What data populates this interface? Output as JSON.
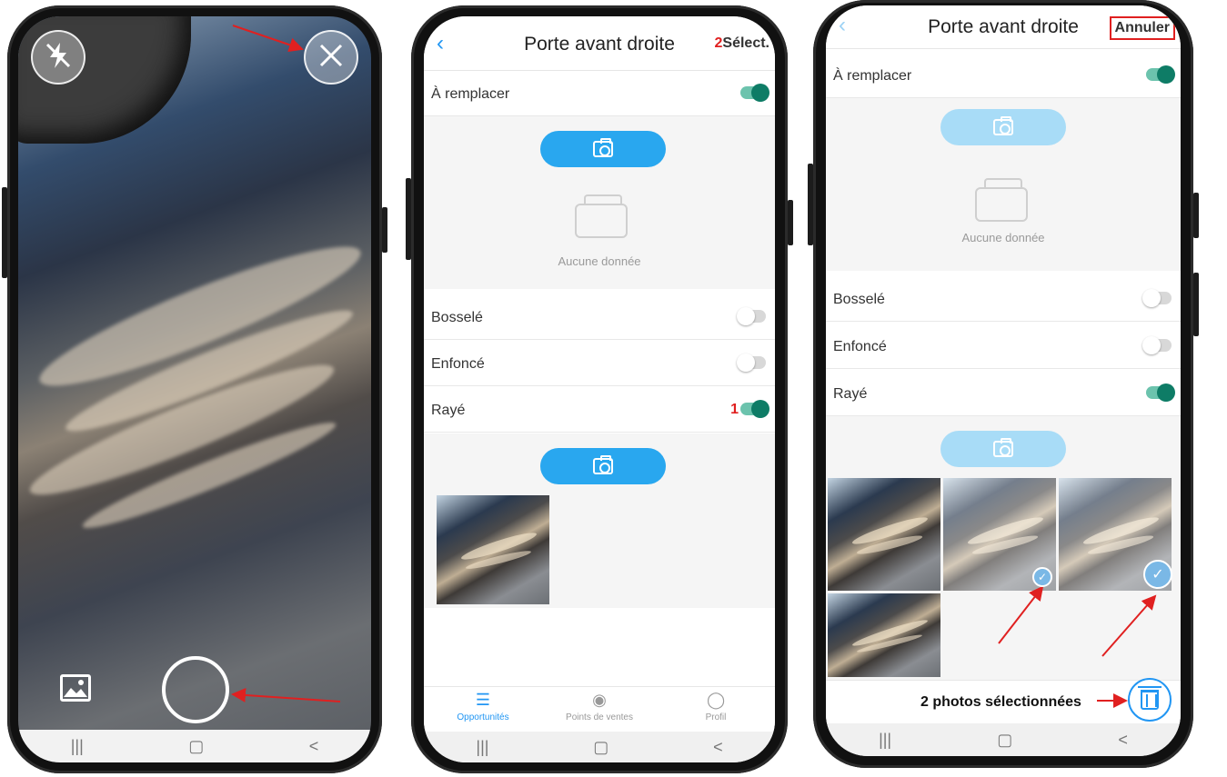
{
  "camera_screen": {
    "flash_icon": "flash-off-icon",
    "close_icon": "close-icon",
    "gallery_icon": "image-icon",
    "nav": [
      "|||",
      "▢",
      "<"
    ]
  },
  "detail_screen": {
    "title": "Porte avant droite",
    "select_marker": "2",
    "select_label": "Sélect.",
    "rows": {
      "a_remplacer": "À remplacer",
      "bossele": "Bosselé",
      "enfonce": "Enfoncé",
      "raye": "Rayé"
    },
    "raye_marker": "1",
    "empty_text": "Aucune donnée",
    "tabs": [
      "Opportunités",
      "Points de ventes",
      "Profil"
    ],
    "nav": [
      "|||",
      "▢",
      "<"
    ]
  },
  "select_screen": {
    "title": "Porte avant droite",
    "cancel_label": "Annuler",
    "rows": {
      "a_remplacer": "À remplacer",
      "bossele": "Bosselé",
      "enfonce": "Enfoncé",
      "raye": "Rayé"
    },
    "empty_text": "Aucune donnée",
    "selection_text": "2 photos sélectionnées",
    "nav": [
      "|||",
      "▢",
      "<"
    ]
  },
  "colors": {
    "accent": "#2196f3",
    "toggle_on": "#0e7c66",
    "annotation": "#e02020"
  }
}
